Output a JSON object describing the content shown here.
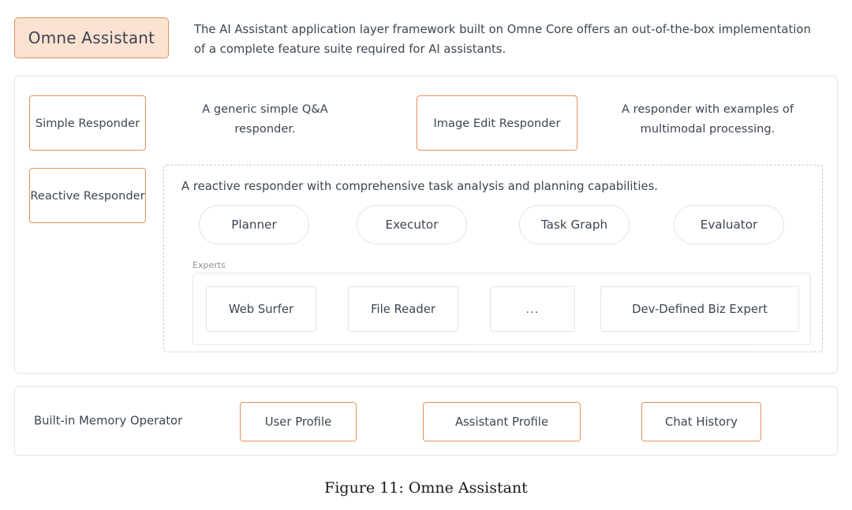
{
  "header": {
    "title_badge": "Omne Assistant",
    "description": "The AI Assistant application layer framework built on Omne Core offers an out-of-the-box implementation of a complete feature suite required for AI assistants."
  },
  "main": {
    "responders": [
      {
        "label": "Simple Responder",
        "description": "A generic simple Q&A responder."
      },
      {
        "label": "Image Edit Responder",
        "description": "A responder with examples of multimodal processing."
      },
      {
        "label": "Reactive Responder",
        "description": "A reactive responder with comprehensive task analysis and planning capabilities."
      }
    ],
    "pipeline_nodes": [
      {
        "label": "Planner"
      },
      {
        "label": "Executor"
      },
      {
        "label": "Task Graph"
      },
      {
        "label": "Evaluator"
      }
    ],
    "experts_label": "Experts",
    "experts": [
      {
        "label": "Web Surfer"
      },
      {
        "label": "File Reader"
      },
      {
        "label": "..."
      },
      {
        "label": "Dev-Defined Biz Expert"
      }
    ]
  },
  "memory": {
    "label": "Built-in Memory Operator",
    "items": [
      {
        "label": "User Profile"
      },
      {
        "label": "Assistant Profile"
      },
      {
        "label": "Chat History"
      }
    ]
  },
  "caption": "Figure 11: Omne Assistant",
  "colors": {
    "accent_orange": "#e8915a",
    "accent_fill": "#fbe2d1",
    "panel_border": "#dfe4e9",
    "dashed_border": "#c3c9d1",
    "text": "#3c4552",
    "muted_text": "#8d949d",
    "arrow": "#5b6472"
  }
}
